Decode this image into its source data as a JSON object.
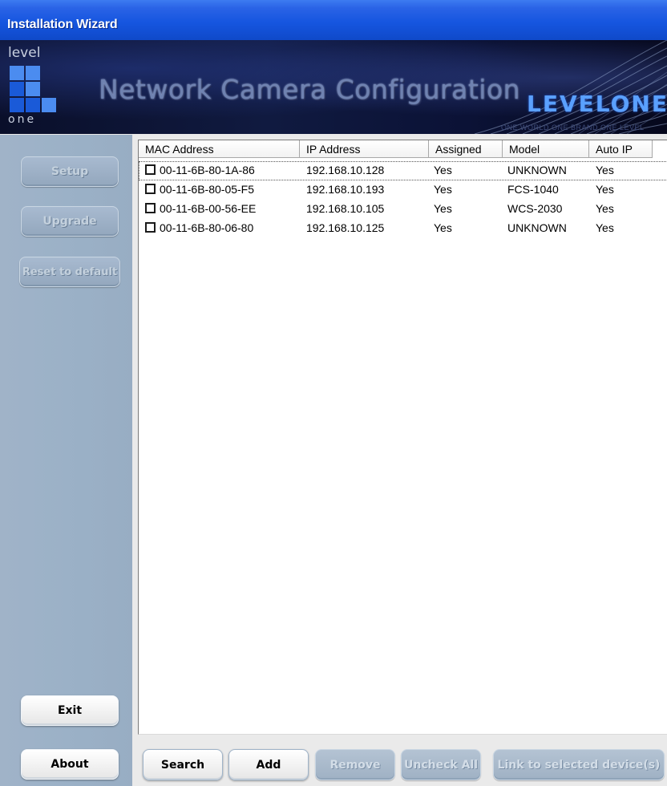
{
  "window": {
    "title": "Installation Wizard"
  },
  "banner": {
    "logo_top": "level",
    "logo_bottom": "one",
    "title": "Network Camera Configuration",
    "brand": "LEVELONE",
    "tagline": "ONE WORLD ONE BRAND ONE LEVEL"
  },
  "sidebar": {
    "setup": "Setup",
    "upgrade": "Upgrade",
    "reset": "Reset to default",
    "exit": "Exit",
    "about": "About"
  },
  "table": {
    "columns": [
      "MAC Address",
      "IP Address",
      "Assigned",
      "Model",
      "Auto IP"
    ],
    "rows": [
      {
        "mac": "00-11-6B-80-1A-86",
        "ip": "192.168.10.128",
        "assigned": "Yes",
        "model": "UNKNOWN",
        "auto_ip": "Yes",
        "checked": false
      },
      {
        "mac": "00-11-6B-80-05-F5",
        "ip": "192.168.10.193",
        "assigned": "Yes",
        "model": "FCS-1040",
        "auto_ip": "Yes",
        "checked": false
      },
      {
        "mac": "00-11-6B-00-56-EE",
        "ip": "192.168.10.105",
        "assigned": "Yes",
        "model": "WCS-2030",
        "auto_ip": "Yes",
        "checked": false
      },
      {
        "mac": "00-11-6B-80-06-80",
        "ip": "192.168.10.125",
        "assigned": "Yes",
        "model": "UNKNOWN",
        "auto_ip": "Yes",
        "checked": false
      }
    ]
  },
  "toolbar": {
    "search": "Search",
    "add": "Add",
    "remove": "Remove",
    "uncheck_all": "Uncheck All",
    "link": "Link to selected device(s)"
  },
  "colors": {
    "titlebar": "#1656e0",
    "sidebar": "#9bb1c7",
    "brand": "#5aa0ff"
  }
}
